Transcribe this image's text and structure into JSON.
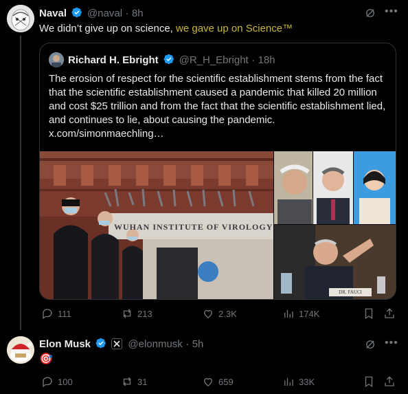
{
  "tweet1": {
    "author_name": "Naval",
    "handle": "@naval",
    "time": "8h",
    "text_plain": "We didn’t give up on science, ",
    "text_highlight": "we gave up on Science™",
    "quote": {
      "author_name": "Richard H. Ebright",
      "handle": "@R_H_Ebright",
      "time": "18h",
      "text": "The erosion of respect for the scientific establishment stems from the fact that the scientific establishment caused a pandemic that killed 20 million and cost $25 trillion and from the fact that the scientific establishment lied, and continues to lie, about causing the pandemic. x.com/simonmaechling…",
      "building_sign": "WUHAN INSTITUTE OF VIROLOGY",
      "nameplate": "DR. FAUCI"
    },
    "actions": {
      "replies": "111",
      "reposts": "213",
      "likes": "2.3K",
      "views": "174K"
    }
  },
  "tweet2": {
    "author_name": "Elon Musk",
    "handle": "@elonmusk",
    "time": "5h",
    "text": "🎯",
    "actions": {
      "replies": "100",
      "reposts": "31",
      "likes": "659",
      "views": "33K"
    }
  },
  "separator": "·",
  "colors": {
    "verified": "#1d9bf0",
    "highlight": "#c9b73a",
    "muted": "#71767b",
    "background": "#000000"
  }
}
